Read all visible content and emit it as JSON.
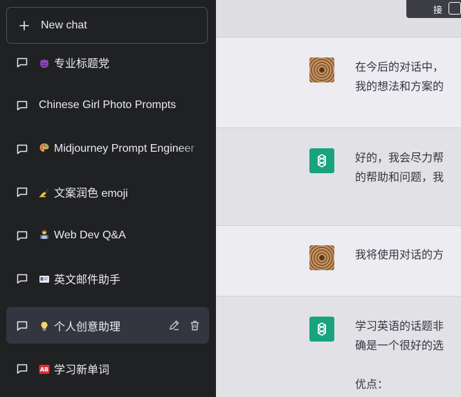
{
  "sidebar": {
    "new_chat_label": "New chat",
    "chats": [
      {
        "emoji": "smiling-devil",
        "label": "专业标题党",
        "active": false
      },
      {
        "emoji": "",
        "label": "Chinese Girl Photo Prompts",
        "active": false
      },
      {
        "emoji": "artist-palette",
        "label": "Midjourney Prompt Engineer",
        "active": false
      },
      {
        "emoji": "writing-hand",
        "label": "文案润色 emoji",
        "active": false
      },
      {
        "emoji": "technologist",
        "label": "Web Dev Q&A",
        "active": false
      },
      {
        "emoji": "id-card",
        "label": "英文邮件助手",
        "active": false
      },
      {
        "emoji": "light-bulb",
        "label": "个人创意助理",
        "active": true
      },
      {
        "emoji": "ab-button",
        "label": "学习新单词",
        "active": false
      }
    ]
  },
  "top_control": {
    "text": "接"
  },
  "conversation": [
    {
      "role": "user",
      "lines": [
        "在今后的对话中，",
        "我的想法和方案的"
      ]
    },
    {
      "role": "assistant",
      "lines": [
        "好的，我会尽力帮",
        "的帮助和问题，我"
      ]
    },
    {
      "role": "user",
      "lines": [
        "我将使用对话的方"
      ]
    },
    {
      "role": "assistant",
      "lines": [
        "学习英语的话题非",
        "确是一个很好的选",
        "",
        "优点："
      ]
    }
  ],
  "colors": {
    "sidebar_bg": "#202123",
    "active_item_bg": "#343541",
    "assistant_avatar": "#19a37f",
    "main_bg": "#ececf1",
    "assistant_row_bg": "#e2e2e6"
  }
}
